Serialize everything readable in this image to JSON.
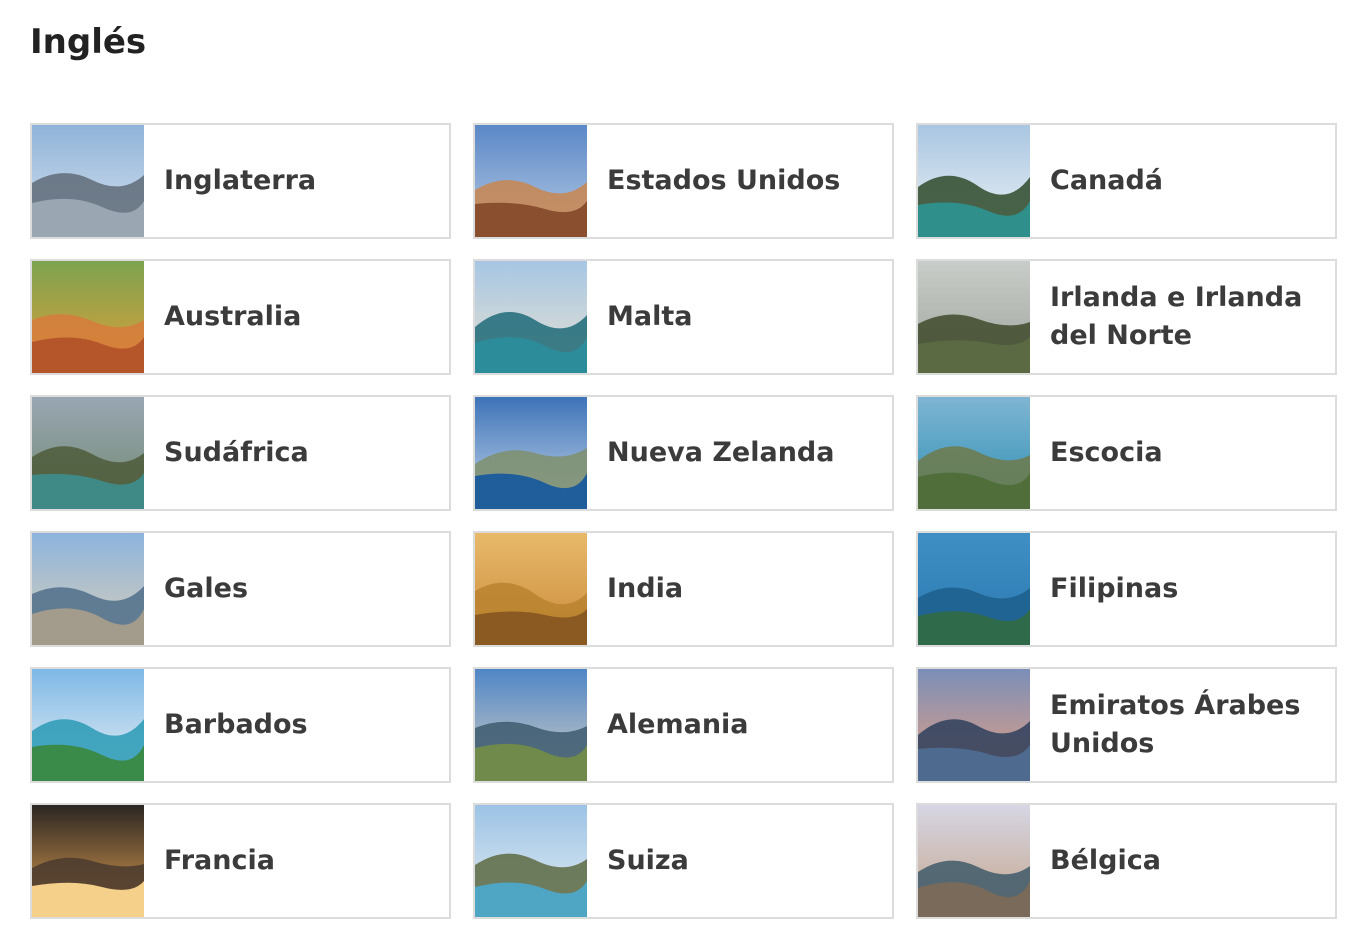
{
  "page": {
    "title": "Inglés"
  },
  "destinations": [
    {
      "label": "Inglaterra",
      "image": "london-eye-thumbnail",
      "palette": [
        "#8fb3d9",
        "#d8e3ee",
        "#9aa7b3",
        "#5f6b78"
      ]
    },
    {
      "label": "Estados Unidos",
      "image": "monument-valley-thumbnail",
      "palette": [
        "#5b88c7",
        "#b7cbe4",
        "#8a4f2e",
        "#c9864f"
      ]
    },
    {
      "label": "Canadá",
      "image": "mountain-lake-thumbnail",
      "palette": [
        "#a9c6e2",
        "#eef2f5",
        "#2f8f8a",
        "#2e4a2a"
      ]
    },
    {
      "label": "Australia",
      "image": "outback-road-signs-thumbnail",
      "palette": [
        "#7da34f",
        "#e0a03a",
        "#b5552a",
        "#d77b3c"
      ]
    },
    {
      "label": "Malta",
      "image": "harbour-boats-thumbnail",
      "palette": [
        "#a7c6e3",
        "#e8e2d2",
        "#2d8c9a",
        "#1f6a78"
      ]
    },
    {
      "label": "Irlanda e Irlanda del Norte",
      "image": "coastal-cliffs-thumbnail",
      "palette": [
        "#c9cdc9",
        "#9ea39c",
        "#5c6a43",
        "#3f4a2c"
      ]
    },
    {
      "label": "Sudáfrica",
      "image": "river-canyon-thumbnail",
      "palette": [
        "#9aa6b4",
        "#6f8a6e",
        "#3f8a86",
        "#4d5a3a"
      ]
    },
    {
      "label": "Nueva Zelanda",
      "image": "alpine-lake-town-thumbnail",
      "palette": [
        "#3e73b8",
        "#c4d6ea",
        "#1f5e9a",
        "#7f8f6c"
      ]
    },
    {
      "label": "Escocia",
      "image": "sea-cliff-thumbnail",
      "palette": [
        "#7fb5d3",
        "#2d8fb3",
        "#4f6e3a",
        "#6e7a4a"
      ]
    },
    {
      "label": "Gales",
      "image": "castle-bridge-thumbnail",
      "palette": [
        "#8db4dd",
        "#d9cfb8",
        "#a39c8c",
        "#4f6e8a"
      ]
    },
    {
      "label": "India",
      "image": "palace-lake-sunset-thumbnail",
      "palette": [
        "#e8b96a",
        "#c98a3a",
        "#8a5a22",
        "#b9822e"
      ]
    },
    {
      "label": "Filipinas",
      "image": "tropical-islands-thumbnail",
      "palette": [
        "#3f8fc4",
        "#2a78b0",
        "#2f6a4a",
        "#1c5f8c"
      ]
    },
    {
      "label": "Barbados",
      "image": "palm-beach-thumbnail",
      "palette": [
        "#7fb8e6",
        "#e9f1f4",
        "#3a8a4a",
        "#2a9ab5"
      ]
    },
    {
      "label": "Alemania",
      "image": "neuschwanstein-thumbnail",
      "palette": [
        "#4f86c6",
        "#d6d0c4",
        "#6f8a4a",
        "#3d5a6e"
      ]
    },
    {
      "label": "Emiratos Árabes Unidos",
      "image": "dubai-skyline-thumbnail",
      "palette": [
        "#7b8fb8",
        "#e8a080",
        "#4e6a8e",
        "#2e3f5c"
      ]
    },
    {
      "label": "Francia",
      "image": "train-window-sunset-thumbnail",
      "palette": [
        "#2a2622",
        "#e8a454",
        "#f4d08a",
        "#4a3a2e"
      ]
    },
    {
      "label": "Suiza",
      "image": "swiss-lake-thumbnail",
      "palette": [
        "#9cc3e6",
        "#e7eef2",
        "#4fa5c4",
        "#5c6a42"
      ]
    },
    {
      "label": "Bélgica",
      "image": "canal-houses-thumbnail",
      "palette": [
        "#d6d6e4",
        "#c5a58a",
        "#7a6a5a",
        "#3f5a6a"
      ]
    }
  ]
}
